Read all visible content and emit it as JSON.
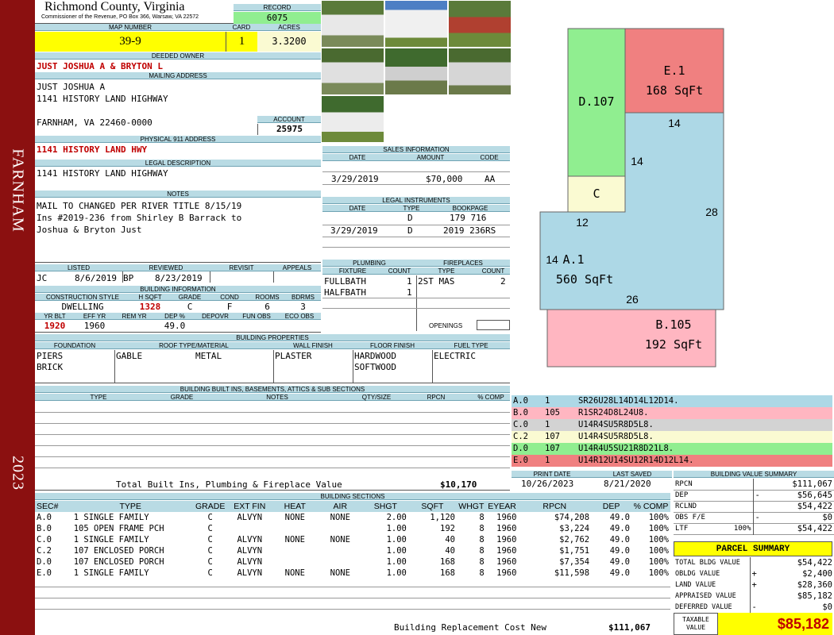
{
  "county": {
    "name": "Richmond County, Virginia",
    "commissioner": "Commissioner of the Revenue, PO Box 366, Warsaw, VA 22572"
  },
  "sidebar": {
    "town": "FARNHAM",
    "year": "2023"
  },
  "record": {
    "label": "RECORD",
    "value": "6075"
  },
  "map": {
    "label": "MAP NUMBER",
    "value": "39-9"
  },
  "card": {
    "label": "CARD",
    "value": "1"
  },
  "acres": {
    "label": "ACRES",
    "value": "3.3200"
  },
  "owner": {
    "label": "DEEDED OWNER",
    "value": "JUST JOSHUA A & BRYTON L"
  },
  "mailing": {
    "label": "MAILING ADDRESS",
    "line1": "JUST JOSHUA A",
    "line2": "1141 HISTORY LAND HIGHWAY",
    "line3": "FARNHAM, VA 22460-0000"
  },
  "account": {
    "label": "ACCOUNT",
    "value": "25975"
  },
  "physical": {
    "label": "PHYSICAL 911 ADDRESS",
    "value": "1141 HISTORY LAND HWY"
  },
  "legal": {
    "label": "LEGAL DESCRIPTION",
    "value": "1141 HISTORY LAND HIGHWAY"
  },
  "notes": {
    "label": "NOTES",
    "line1": "MAIL TO CHANGED PER RIVER TITLE 8/15/19",
    "line2": "Ins #2019-236 from Shirley B Barrack to",
    "line3": "Joshua & Bryton Just"
  },
  "listed": {
    "label": "LISTED",
    "by": "JC",
    "date": "8/6/2019"
  },
  "reviewed": {
    "label": "REVIEWED",
    "by": "BP",
    "date": "8/23/2019"
  },
  "revisit": {
    "label": "REVISIT"
  },
  "appeals": {
    "label": "APPEALS"
  },
  "bldg_info": {
    "label": "BUILDING INFORMATION",
    "h_style": "CONSTRUCTION STYLE",
    "h_hsqft": "H SQFT",
    "h_grade": "GRADE",
    "h_cond": "COND",
    "h_rooms": "ROOMS",
    "h_bdrms": "BDRMS",
    "style": "DWELLING",
    "hsqft": "1328",
    "grade": "C",
    "cond": "F",
    "rooms": "6",
    "bdrms": "3",
    "h_yrblt": "YR BLT",
    "h_effyr": "EFF YR",
    "h_remyr": "REM YR",
    "h_dep": "DEP %",
    "h_depovr": "DEPOVR",
    "h_funobs": "FUN OBS",
    "h_ecoobs": "ECO OBS",
    "yrblt": "1920",
    "effyr": "1960",
    "dep": "49.0"
  },
  "sales": {
    "label": "SALES INFORMATION",
    "h_date": "DATE",
    "h_amount": "AMOUNT",
    "h_code": "CODE",
    "date": "3/29/2019",
    "amount": "$70,000",
    "code": "AA"
  },
  "instruments": {
    "label": "LEGAL INSTRUMENTS",
    "h_date": "DATE",
    "h_type": "TYPE",
    "h_book": "BOOKPAGE",
    "rows": [
      {
        "date": "",
        "type": "D",
        "book": "179 716"
      },
      {
        "date": "3/29/2019",
        "type": "D",
        "book": "2019 236RS"
      }
    ]
  },
  "plumbing": {
    "label": "PLUMBING",
    "h_fixture": "FIXTURE",
    "h_count": "COUNT",
    "rows": [
      {
        "fixture": "FULLBATH",
        "count": "1"
      },
      {
        "fixture": "HALFBATH",
        "count": "1"
      }
    ]
  },
  "fireplaces": {
    "label": "FIREPLACES",
    "h_type": "TYPE",
    "h_count": "COUNT",
    "type": "2ST MAS",
    "count": "2",
    "openings": "OPENINGS"
  },
  "props": {
    "label": "BUILDING PROPERTIES",
    "h_found": "FOUNDATION",
    "h_roof": "ROOF TYPE/MATERIAL",
    "h_wall": "WALL FINISH",
    "h_floor": "FLOOR FINISH",
    "h_fuel": "FUEL TYPE",
    "found1": "PIERS",
    "found2": "BRICK",
    "roof1": "GABLE",
    "roof2": "METAL",
    "wall": "PLASTER",
    "floor1": "HARDWOOD",
    "floor2": "SOFTWOOD",
    "fuel": "ELECTRIC"
  },
  "builtins": {
    "label": "BUILDING BUILT INS, BASEMENTS, ATTICS & SUB SECTIONS",
    "h_type": "TYPE",
    "h_grade": "GRADE",
    "h_notes": "NOTES",
    "h_qty": "QTY/SIZE",
    "h_rpcn": "RPCN",
    "h_comp": "% COMP",
    "total_label": "Total Built Ins, Plumbing & Fireplace Value",
    "total_value": "$10,170"
  },
  "sketch": {
    "sections": [
      {
        "label": "D.107"
      },
      {
        "label": "E.1",
        "area": "168 SqFt"
      },
      {
        "label": "C"
      },
      {
        "label": "A.1",
        "area": "560 SqFt"
      },
      {
        "label": "B.105",
        "area": "192 SqFt"
      }
    ],
    "dims": [
      "14",
      "14",
      "28",
      "12",
      "14",
      "26"
    ],
    "colors": {
      "A": "#add8e6",
      "B": "#ffb6c1",
      "C": "#fafad2",
      "D": "#90ee90",
      "E": "#f08080"
    }
  },
  "segments": [
    {
      "code": "A.0",
      "num": "1",
      "path": "SR26U28L14D14L12D14."
    },
    {
      "code": "B.0",
      "num": "105",
      "path": "R1SR24D8L24U8."
    },
    {
      "code": "C.0",
      "num": "1",
      "path": "U14R4SU5R8D5L8."
    },
    {
      "code": "C.2",
      "num": "107",
      "path": "U14R4SU5R8D5L8."
    },
    {
      "code": "D.0",
      "num": "107",
      "path": "U14R4U5SU21R8D21L8."
    },
    {
      "code": "E.0",
      "num": "1",
      "path": "U14R12U14SU12R14D12L14."
    }
  ],
  "print": {
    "label_print": "PRINT DATE",
    "label_saved": "LAST SAVED",
    "print_date": "10/26/2023",
    "last_saved": "8/21/2020"
  },
  "sections": {
    "label": "BUILDING SECTIONS",
    "h_sec": "SEC#",
    "h_type": "TYPE",
    "h_grade": "GRADE",
    "h_ext": "EXT FIN",
    "h_heat": "HEAT",
    "h_air": "AIR",
    "h_shgt": "SHGT",
    "h_sqft": "SQFT",
    "h_whgt": "WHGT",
    "h_eyear": "EYEAR",
    "h_rpcn": "RPCN",
    "h_dep": "DEP",
    "h_comp": "% COMP",
    "rows": [
      {
        "sec": "A.0",
        "type": "1 SINGLE FAMILY",
        "grade": "C",
        "ext": "ALVYN",
        "heat": "NONE",
        "air": "NONE",
        "shgt": "2.00",
        "sqft": "1,120",
        "whgt": "8",
        "eyear": "1960",
        "rpcn": "$74,208",
        "dep": "49.0",
        "comp": "100%"
      },
      {
        "sec": "B.0",
        "type": "105 OPEN FRAME PCH",
        "grade": "C",
        "ext": "",
        "heat": "",
        "air": "",
        "shgt": "1.00",
        "sqft": "192",
        "whgt": "8",
        "eyear": "1960",
        "rpcn": "$3,224",
        "dep": "49.0",
        "comp": "100%"
      },
      {
        "sec": "C.0",
        "type": "1 SINGLE FAMILY",
        "grade": "C",
        "ext": "ALVYN",
        "heat": "NONE",
        "air": "NONE",
        "shgt": "1.00",
        "sqft": "40",
        "whgt": "8",
        "eyear": "1960",
        "rpcn": "$2,762",
        "dep": "49.0",
        "comp": "100%"
      },
      {
        "sec": "C.2",
        "type": "107 ENCLOSED PORCH",
        "grade": "C",
        "ext": "ALVYN",
        "heat": "",
        "air": "",
        "shgt": "1.00",
        "sqft": "40",
        "whgt": "8",
        "eyear": "1960",
        "rpcn": "$1,751",
        "dep": "49.0",
        "comp": "100%"
      },
      {
        "sec": "D.0",
        "type": "107 ENCLOSED PORCH",
        "grade": "C",
        "ext": "ALVYN",
        "heat": "",
        "air": "",
        "shgt": "1.00",
        "sqft": "168",
        "whgt": "8",
        "eyear": "1960",
        "rpcn": "$7,354",
        "dep": "49.0",
        "comp": "100%"
      },
      {
        "sec": "E.0",
        "type": "1 SINGLE FAMILY",
        "grade": "C",
        "ext": "ALVYN",
        "heat": "NONE",
        "air": "NONE",
        "shgt": "1.00",
        "sqft": "168",
        "whgt": "8",
        "eyear": "1960",
        "rpcn": "$11,598",
        "dep": "49.0",
        "comp": "100%"
      }
    ],
    "replacement_label": "Building Replacement Cost New",
    "replacement_value": "$111,067"
  },
  "value_summary": {
    "label": "BUILDING VALUE SUMMARY",
    "rows": [
      {
        "k": "RPCN",
        "sign": "",
        "v": "$111,067"
      },
      {
        "k": "DEP",
        "sign": "-",
        "v": "$56,645"
      },
      {
        "k": "RCLND",
        "sign": "",
        "v": "$54,422"
      },
      {
        "k": "OBS F/E",
        "sign": "-",
        "v": "$0"
      },
      {
        "k": "LTF",
        "pct": "100%",
        "sign": "",
        "v": "$54,422"
      }
    ]
  },
  "parcel": {
    "label": "PARCEL SUMMARY",
    "rows": [
      {
        "k": "TOTAL BLDG VALUE",
        "sign": "",
        "v": "$54,422"
      },
      {
        "k": "OBLDG VALUE",
        "sign": "+",
        "v": "$2,400"
      },
      {
        "k": "LAND VALUE",
        "sign": "+",
        "v": "$28,360"
      },
      {
        "k": "APPRAISED VALUE",
        "sign": "",
        "v": "$85,182"
      },
      {
        "k": "DEFERRED VALUE",
        "sign": "-",
        "v": "$0"
      }
    ],
    "taxable_label1": "TAXABLE",
    "taxable_label2": "VALUE",
    "taxable_value": "$85,182"
  }
}
